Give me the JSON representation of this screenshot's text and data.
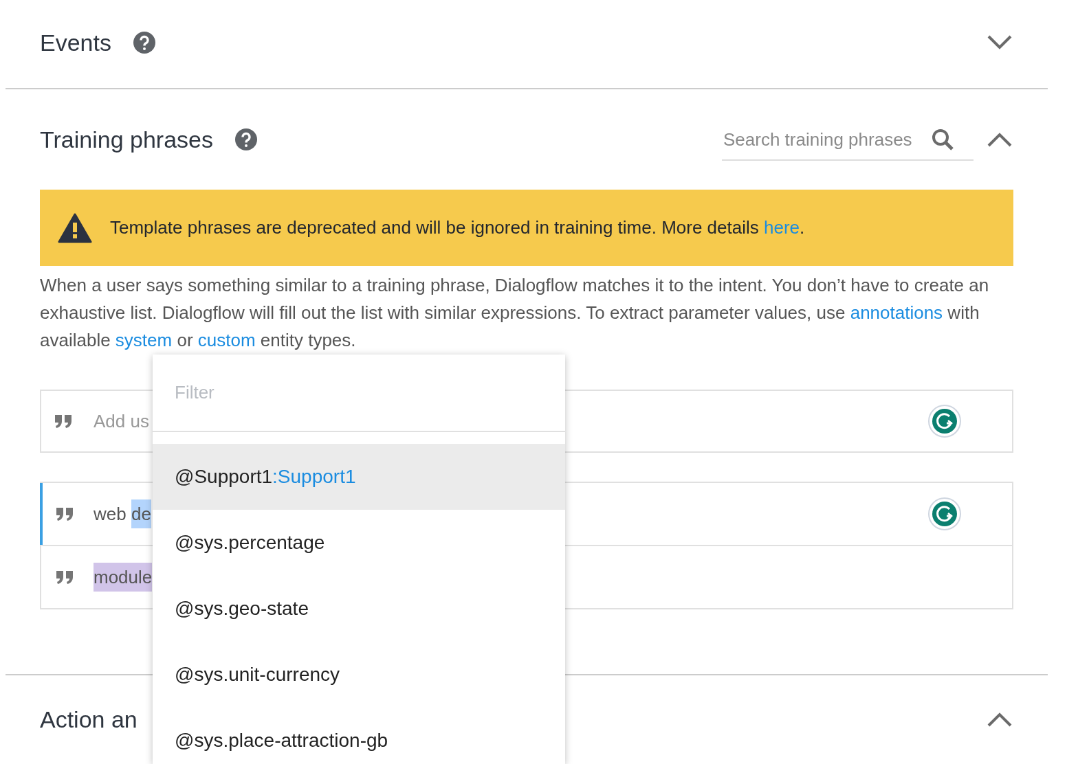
{
  "events": {
    "title": "Events",
    "help": true,
    "expanded": false
  },
  "training": {
    "title": "Training phrases",
    "help": true,
    "expanded": true,
    "search": {
      "placeholder": "Search training phrases"
    },
    "warning": {
      "parts": [
        {
          "text": "Template phrases are deprecated and will be ignored in training time. More details ",
          "link": false
        },
        {
          "text": "here",
          "link": true
        },
        {
          "text": ".",
          "link": false
        }
      ]
    },
    "description": [
      {
        "text": "When a user says something similar to a training phrase, Dialogflow matches it to the intent. You don’t have to create an exhaustive list. Dialogflow will fill out the list with similar expressions. To extract parameter values, use ",
        "link": false
      },
      {
        "text": "annotations",
        "link": true
      },
      {
        "text": " with available ",
        "link": false
      },
      {
        "text": "system",
        "link": true
      },
      {
        "text": " or ",
        "link": false
      },
      {
        "text": "custom",
        "link": true
      },
      {
        "text": " entity types.",
        "link": false
      }
    ],
    "add_field": {
      "placeholder": "Add us"
    },
    "phrases": [
      {
        "selected": true,
        "parts": [
          {
            "text": "web "
          },
          {
            "text": "de",
            "color": "#b3d4fc"
          }
        ]
      },
      {
        "selected": false,
        "parts": [
          {
            "text": "module",
            "color": "#d1c4e9"
          }
        ]
      }
    ]
  },
  "action": {
    "title": "Action an",
    "help": false,
    "expanded": true
  },
  "entity_menu": {
    "placeholder": "Filter",
    "items": [
      {
        "entity": "@Support1",
        "value": ":Support1",
        "selected": true
      },
      {
        "entity": "@sys.percentage",
        "selected": false
      },
      {
        "entity": "@sys.geo-state",
        "selected": false
      },
      {
        "entity": "@sys.unit-currency",
        "selected": false
      },
      {
        "entity": "@sys.place-attraction-gb",
        "selected": false
      }
    ]
  }
}
